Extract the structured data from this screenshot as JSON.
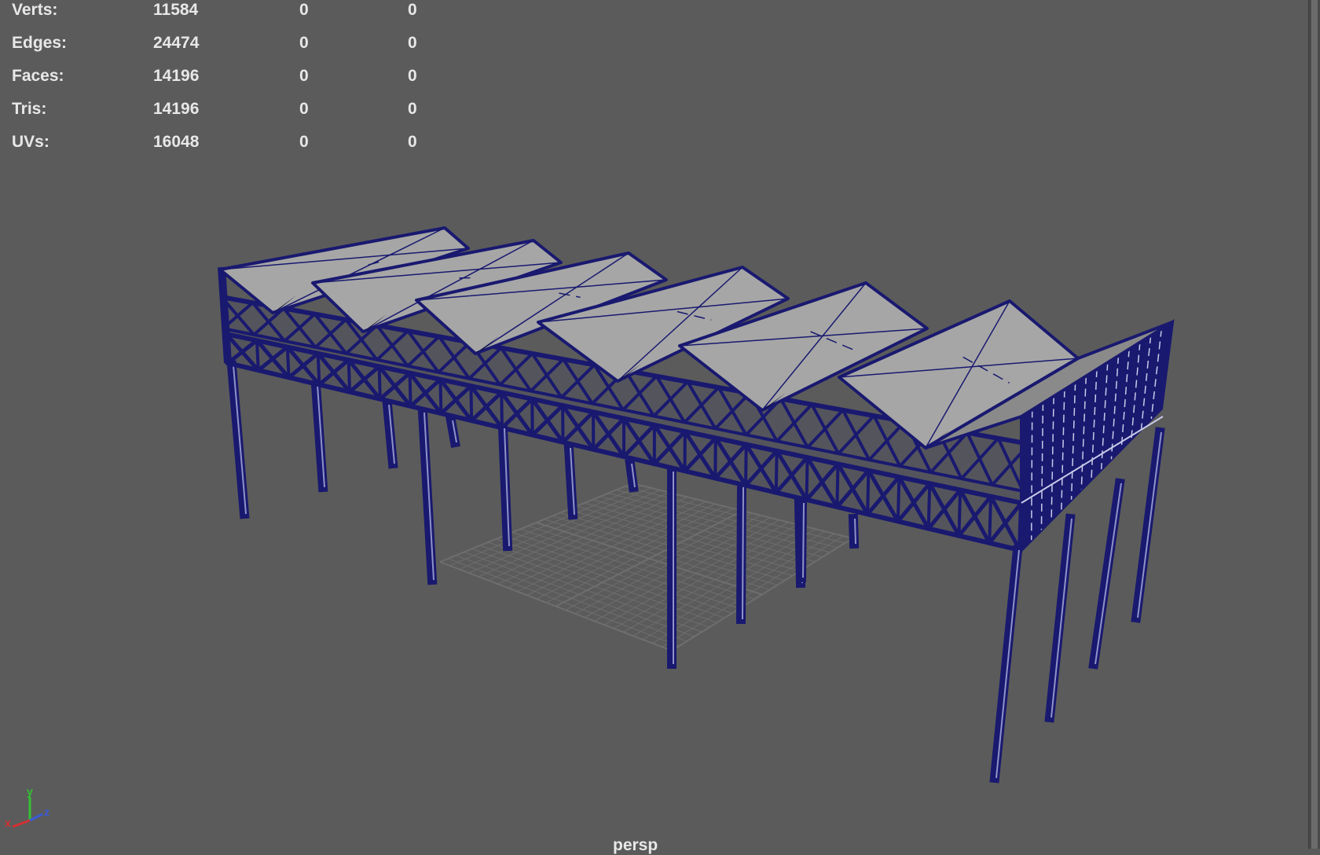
{
  "stats": {
    "rows": [
      {
        "label": "Verts:",
        "v1": "11584",
        "v2": "0",
        "v3": "0"
      },
      {
        "label": "Edges:",
        "v1": "24474",
        "v2": "0",
        "v3": "0"
      },
      {
        "label": "Faces:",
        "v1": "14196",
        "v2": "0",
        "v3": "0"
      },
      {
        "label": "Tris:",
        "v1": "14196",
        "v2": "0",
        "v3": "0"
      },
      {
        "label": "UVs:",
        "v1": "16048",
        "v2": "0",
        "v3": "0"
      }
    ]
  },
  "axis": {
    "x": "x",
    "y": "y",
    "z": "z"
  },
  "camera": {
    "label": "persp"
  },
  "colors": {
    "viewport_bg": "#5b5b5b",
    "wire": "#191970",
    "roof": "#a6a6a6",
    "grid": "#6e6e6e",
    "axis_x": "#d43030",
    "axis_y": "#33c233",
    "axis_z": "#3a5bd8"
  }
}
